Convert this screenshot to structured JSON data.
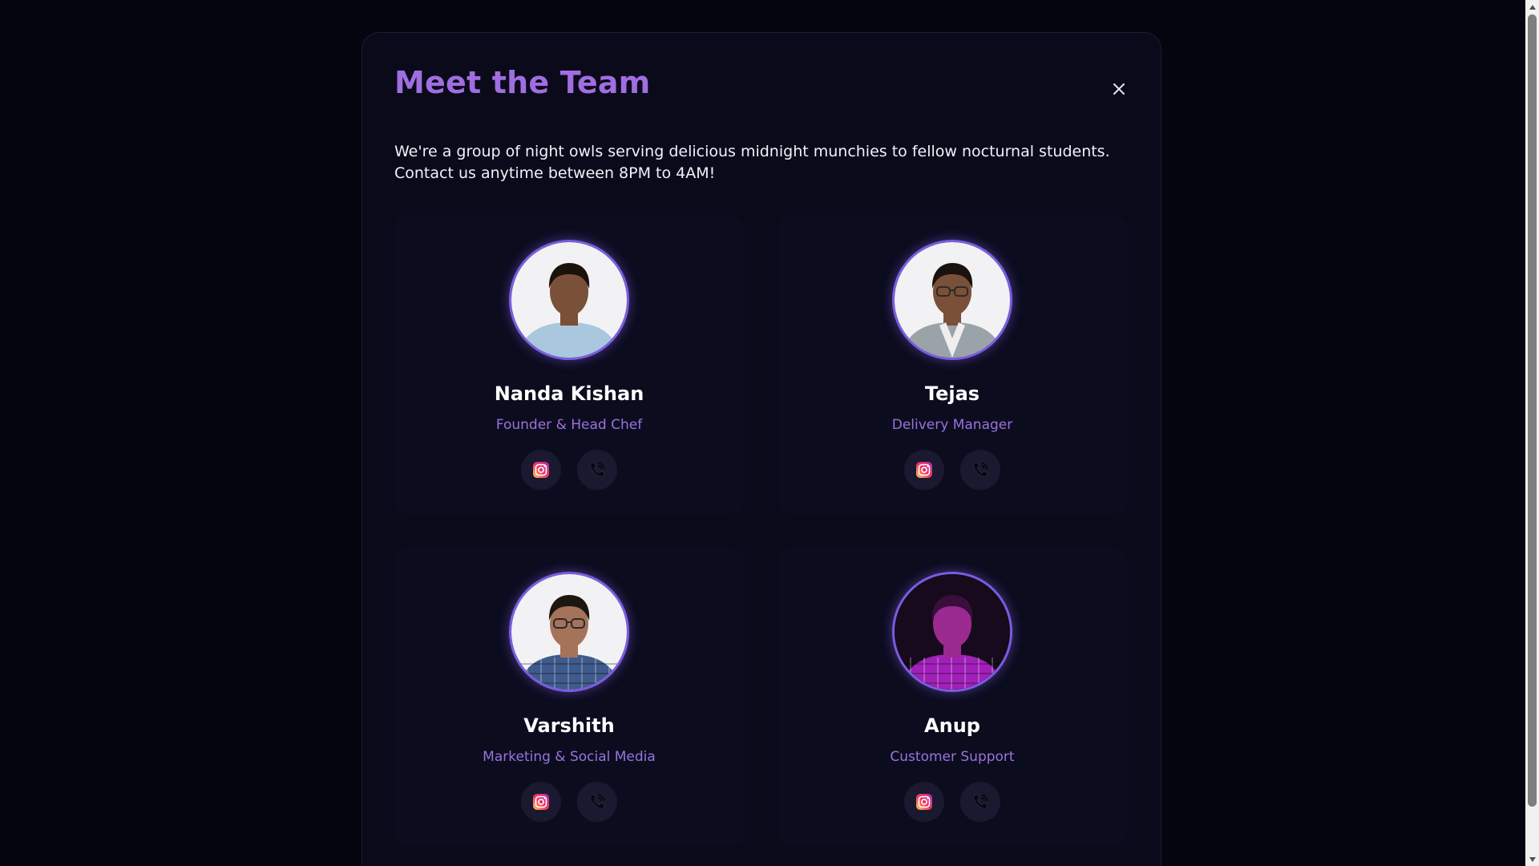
{
  "modal": {
    "title": "Meet the Team",
    "close_label": "×",
    "intro": "We're a group of night owls serving delicious midnight munchies to fellow nocturnal students. Contact us anytime between 8PM to 4AM!"
  },
  "team": [
    {
      "name": "Nanda Kishan",
      "role": "Founder & Head Chef",
      "shirt": "#a9c7dd",
      "skin": "#7a5038",
      "hair": "#1b120c"
    },
    {
      "name": "Tejas",
      "role": "Delivery Manager",
      "shirt": "#9aa3a8",
      "skin": "#7b5038",
      "hair": "#1a120e"
    },
    {
      "name": "Varshith",
      "role": "Marketing & Social Media",
      "shirt": "#3f5a8c",
      "skin": "#a4735a",
      "hair": "#1e1610"
    },
    {
      "name": "Anup",
      "role": "Customer Support",
      "shirt": "#a020b8",
      "skin": "#9a2a90",
      "hair": "#3a0d3c"
    }
  ],
  "icons": {
    "instagram": "instagram-icon",
    "phone": "phone-icon",
    "close": "close-icon"
  },
  "colors": {
    "accent": "#a06ee0",
    "role": "#9a72dd",
    "background": "#050510",
    "card": "#0c0c1f",
    "avatar_ring": "#7b5ce0"
  }
}
